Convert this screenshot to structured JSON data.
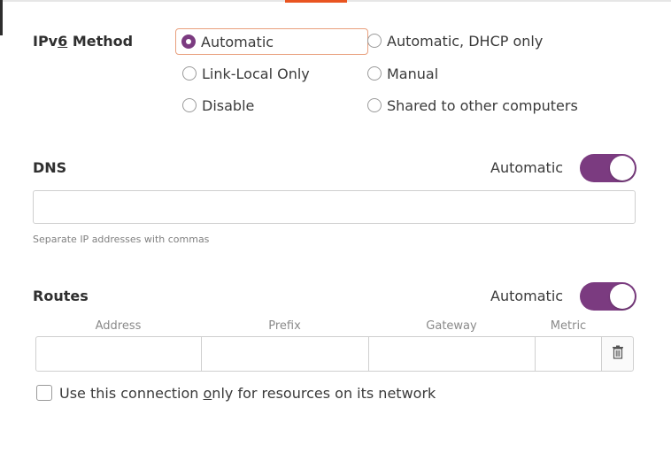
{
  "ipv6_method": {
    "label_pre": "IPv",
    "label_u": "6",
    "label_post": " Method",
    "options": [
      {
        "label": "Automatic",
        "selected": true
      },
      {
        "label": "Automatic, DHCP only",
        "selected": false
      },
      {
        "label": "Link-Local Only",
        "selected": false
      },
      {
        "label": "Manual",
        "selected": false
      },
      {
        "label": "Disable",
        "selected": false
      },
      {
        "label": "Shared to other computers",
        "selected": false
      }
    ]
  },
  "dns": {
    "label": "DNS",
    "automatic_label": "Automatic",
    "automatic_on": true,
    "value": "",
    "hint": "Separate IP addresses with commas"
  },
  "routes": {
    "label": "Routes",
    "automatic_label": "Automatic",
    "automatic_on": true,
    "columns": [
      "Address",
      "Prefix",
      "Gateway",
      "Metric"
    ],
    "row": {
      "address": "",
      "prefix": "",
      "gateway": "",
      "metric": ""
    }
  },
  "only_local": {
    "label_pre": "Use this connection ",
    "label_u": "o",
    "label_post": "nly for resources on its network",
    "checked": false
  },
  "colors": {
    "accent": "#7b3b80",
    "focus": "#e95420"
  },
  "icons": {
    "delete": "trash-icon"
  }
}
